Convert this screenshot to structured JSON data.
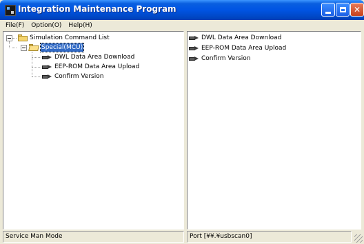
{
  "window": {
    "title": "Integration Maintenance Program"
  },
  "menu": {
    "items": [
      {
        "label": "File(F)"
      },
      {
        "label": "Option(O)"
      },
      {
        "label": "Help(H)"
      }
    ]
  },
  "tree": {
    "root_label": "Simulation Command List",
    "group_label": "Special(MCU)",
    "commands": [
      {
        "label": "DWL Data Area Download"
      },
      {
        "label": "EEP-ROM Data Area Upload"
      },
      {
        "label": "Confirm Version"
      }
    ]
  },
  "list": {
    "items": [
      {
        "label": "DWL Data Area Download"
      },
      {
        "label": "EEP-ROM Data Area Upload"
      },
      {
        "label": "Confirm Version"
      }
    ]
  },
  "status": {
    "mode": "Service Man Mode",
    "port": "Port [¥¥.¥usbscan0]"
  },
  "icons": {
    "app": "app-icon",
    "folder": "folder-icon",
    "command": "hand-pointer-icon"
  }
}
